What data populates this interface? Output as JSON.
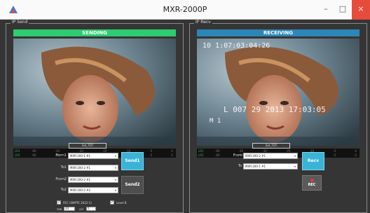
{
  "window": {
    "title": "MXR-2000P",
    "minimize": "–",
    "maximize": "□",
    "close": "×",
    "icon": "app-icon"
  },
  "colors": {
    "sending": "#2ecc71",
    "receiving": "#2d86b8",
    "accent_button": "#3ab4d6"
  },
  "send": {
    "group_label": "IP Send",
    "banner": "SENDING",
    "meter": {
      "row1": "LR1",
      "row2": "LR2",
      "ticks": [
        "-60",
        "-40",
        "-30",
        "-20",
        "-10",
        "-5",
        "0"
      ]
    },
    "timestamp": "Sat_TDT",
    "from1_label": "From1",
    "from1_value": "MXR-200-1 #1",
    "to1_label": "To1",
    "to1_value": "MXR-200-2 #1",
    "send1": "Send1",
    "from2_label": "From2",
    "from2_value": "MXR-200-2 #1",
    "to2_label": "To2",
    "to2_value": "MXR-200-2 #2",
    "send2": "Send2",
    "opt1_label": "FEC (SMPTE 2022-1)",
    "opt1_checked": "✓",
    "opt2_label": "Level B",
    "opt2_checked": "✓",
    "row_label": "row",
    "row_value": "20",
    "col_label": "col",
    "col_value": "5"
  },
  "recv": {
    "group_label": "IP Recv",
    "banner": "RECEIVING",
    "meter": {
      "row1": "LR1",
      "row2": "LR2",
      "ticks": [
        "-60",
        "-40",
        "-30",
        "-20",
        "-10",
        "-5",
        "0"
      ]
    },
    "timestamp": "Sat_TDT",
    "from_label": "From",
    "from_value": "MXR-200-2 #1",
    "to_label": "To",
    "to_value": "MXR-200-1 #1",
    "recv": "Recv",
    "rec": "REC",
    "overlay_top": "10 1:07:03:04:26",
    "overlay_mid": "L 007 29 2013 17:03:05",
    "overlay_bottom": "M 1"
  }
}
